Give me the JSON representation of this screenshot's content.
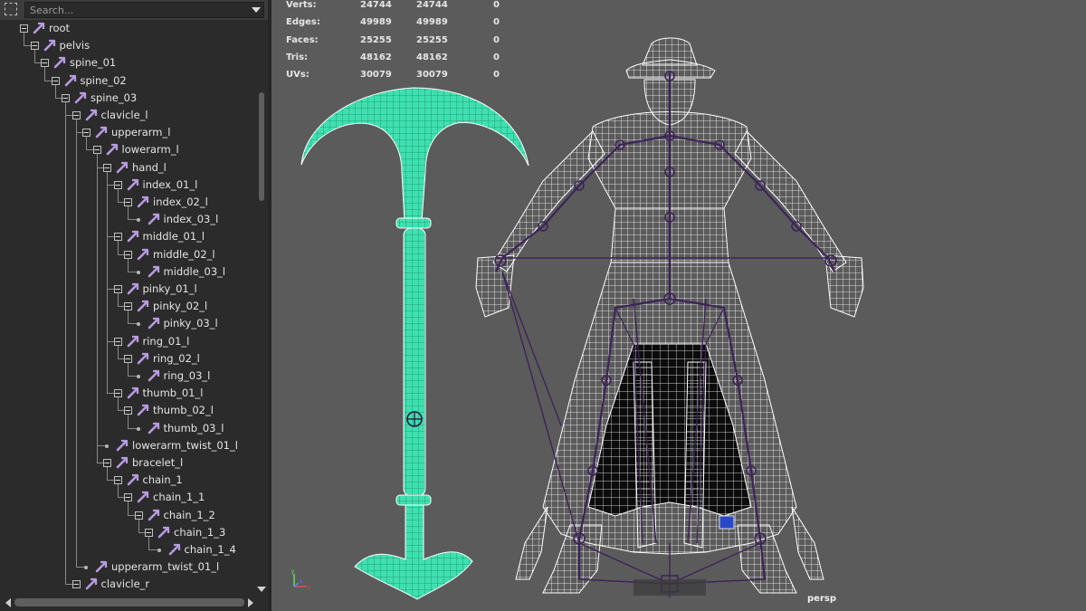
{
  "outliner": {
    "search_placeholder": "Search...",
    "nodes": [
      {
        "name": "root"
      },
      {
        "name": "pelvis"
      },
      {
        "name": "spine_01"
      },
      {
        "name": "spine_02"
      },
      {
        "name": "spine_03"
      },
      {
        "name": "clavicle_l"
      },
      {
        "name": "upperarm_l"
      },
      {
        "name": "lowerarm_l"
      },
      {
        "name": "hand_l"
      },
      {
        "name": "index_01_l"
      },
      {
        "name": "index_02_l"
      },
      {
        "name": "index_03_l"
      },
      {
        "name": "middle_01_l"
      },
      {
        "name": "middle_02_l"
      },
      {
        "name": "middle_03_l"
      },
      {
        "name": "pinky_01_l"
      },
      {
        "name": "pinky_02_l"
      },
      {
        "name": "pinky_03_l"
      },
      {
        "name": "ring_01_l"
      },
      {
        "name": "ring_02_l"
      },
      {
        "name": "ring_03_l"
      },
      {
        "name": "thumb_01_l"
      },
      {
        "name": "thumb_02_l"
      },
      {
        "name": "thumb_03_l"
      },
      {
        "name": "lowerarm_twist_01_l"
      },
      {
        "name": "bracelet_l"
      },
      {
        "name": "chain_1"
      },
      {
        "name": "chain_1_1"
      },
      {
        "name": "chain_1_2"
      },
      {
        "name": "chain_1_3"
      },
      {
        "name": "chain_1_4"
      },
      {
        "name": "upperarm_twist_01_l"
      },
      {
        "name": "clavicle_r"
      }
    ]
  },
  "hud": {
    "rows": [
      {
        "label": "Verts:",
        "v1": "24744",
        "v2": "24744",
        "v3": "0"
      },
      {
        "label": "Edges:",
        "v1": "49989",
        "v2": "49989",
        "v3": "0"
      },
      {
        "label": "Faces:",
        "v1": "25255",
        "v2": "25255",
        "v3": "0"
      },
      {
        "label": "Tris:",
        "v1": "48162",
        "v2": "48162",
        "v3": "0"
      },
      {
        "label": "UVs:",
        "v1": "30079",
        "v2": "30079",
        "v3": "0"
      }
    ]
  },
  "viewport": {
    "camera": "persp",
    "axis_labels": {
      "y": "y",
      "x": "x",
      "z": "z"
    },
    "background_color": "#5b5b5b",
    "wireframe_color": "#ffffff",
    "selected_wireframe_color": "#3fe0b0",
    "joint_color": "#3c2458"
  },
  "colors": {
    "outliner_bg": "#2b2b2b",
    "joint_icon": "#b89be0"
  },
  "icons": {
    "search": "selection-square-icon",
    "joint": "joint-icon",
    "dropdown": "triangle-down-icon"
  }
}
